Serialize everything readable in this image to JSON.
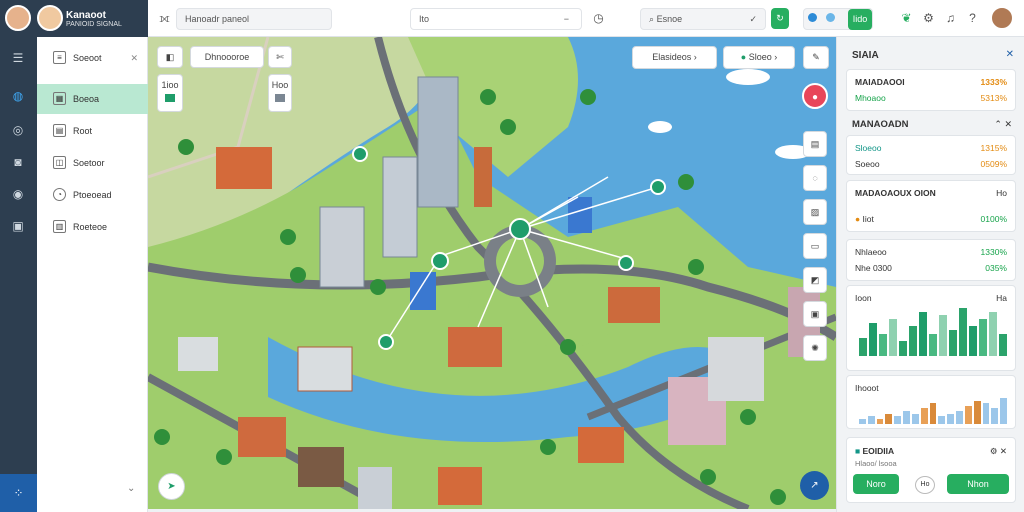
{
  "header": {
    "brand_title": "Kanaoot",
    "brand_subtitle": "PANIOID SIGNAL",
    "search_placeholder": "Hanoadr paneol",
    "location_value": "Ito",
    "filter_value": "Esnoe",
    "action_label": "Iido"
  },
  "sidebar": {
    "items": [
      {
        "label": "Soeoot",
        "icon": "list-icon"
      },
      {
        "label": "Boeoa",
        "icon": "map-icon"
      },
      {
        "label": "Root",
        "icon": "route-icon"
      },
      {
        "label": "Soetoor",
        "icon": "layers-icon"
      },
      {
        "label": "Ptoeoead",
        "icon": "clock-icon"
      },
      {
        "label": "Roeteoe",
        "icon": "report-icon"
      }
    ]
  },
  "map": {
    "route_chip": "Dhnoooroe",
    "layers_chip": "Elasideos",
    "status_chip": "Sloeo",
    "legend": [
      "1ioo",
      "Hoo"
    ]
  },
  "panel": {
    "title": "SIAIA",
    "card1": {
      "title": "MAIADAOOI",
      "value1": "1333%",
      "sub": "Mhoaoo",
      "value2": "5313%"
    },
    "section2_title": "MANAOADN",
    "card2": {
      "rows": [
        {
          "label": "Sloeoo",
          "value": "1315%"
        },
        {
          "label": "Soeoo",
          "value": "0509%"
        }
      ]
    },
    "card3": {
      "title": "MADAOAOUX OION",
      "tag": "Ho",
      "label": "Iiot",
      "value": "0100%"
    },
    "card4": {
      "rows": [
        {
          "label": "Nhlaeoo",
          "value": "1330%"
        },
        {
          "label": "Nhe 0300",
          "value": "035%"
        }
      ]
    },
    "chart1": {
      "title": "Ioon",
      "tag": "Ha"
    },
    "chart2": {
      "title": "Ihooot"
    },
    "footer": {
      "title": "EOIDIIA",
      "sub": "Hlaoo/ lsooa",
      "btn1": "Noro",
      "btn2": "Nhon",
      "btn_mid": "Ho"
    }
  },
  "chart_data": [
    {
      "type": "bar",
      "title": "Ioon",
      "values": [
        5,
        9,
        6,
        10,
        4,
        8,
        12,
        6,
        11,
        7,
        13,
        8,
        10,
        12,
        6
      ]
    },
    {
      "type": "bar",
      "title": "Ihooot",
      "values": [
        2,
        3,
        2,
        4,
        3,
        5,
        4,
        6,
        8,
        3,
        4,
        5,
        7,
        9,
        8,
        6,
        10
      ]
    }
  ]
}
